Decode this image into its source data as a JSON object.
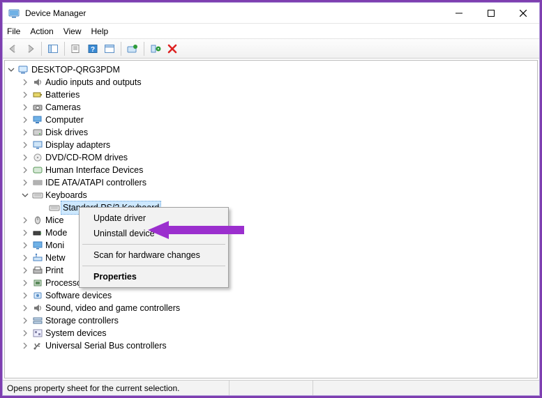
{
  "titlebar": {
    "title": "Device Manager"
  },
  "menu": {
    "file": "File",
    "action": "Action",
    "view": "View",
    "help": "Help"
  },
  "root": {
    "label": "DESKTOP-QRG3PDM"
  },
  "categories": [
    {
      "key": "audio",
      "label": "Audio inputs and outputs",
      "icon": "speaker"
    },
    {
      "key": "batteries",
      "label": "Batteries",
      "icon": "battery"
    },
    {
      "key": "cameras",
      "label": "Cameras",
      "icon": "camera"
    },
    {
      "key": "computer",
      "label": "Computer",
      "icon": "computer"
    },
    {
      "key": "disk",
      "label": "Disk drives",
      "icon": "disk"
    },
    {
      "key": "display",
      "label": "Display adapters",
      "icon": "display"
    },
    {
      "key": "dvd",
      "label": "DVD/CD-ROM drives",
      "icon": "dvd"
    },
    {
      "key": "hid",
      "label": "Human Interface Devices",
      "icon": "hid"
    },
    {
      "key": "ide",
      "label": "IDE ATA/ATAPI controllers",
      "icon": "ide"
    },
    {
      "key": "keyboards",
      "label": "Keyboards",
      "icon": "keyboard",
      "expanded": true,
      "children": [
        {
          "key": "ps2kb",
          "label": "Standard PS/2 Keyboard",
          "icon": "keyboard",
          "selected": true
        }
      ]
    },
    {
      "key": "mice",
      "label": "Mice",
      "icon": "mouse",
      "truncated": true
    },
    {
      "key": "modems",
      "label": "Mode",
      "icon": "modem",
      "truncated": true
    },
    {
      "key": "monitors",
      "label": "Moni",
      "icon": "monitor",
      "truncated": true
    },
    {
      "key": "network",
      "label": "Netw",
      "icon": "network",
      "truncated": true
    },
    {
      "key": "print",
      "label": "Print",
      "icon": "printer",
      "truncated": true
    },
    {
      "key": "processors",
      "label": "Processors",
      "icon": "cpu",
      "truncated": true
    },
    {
      "key": "software",
      "label": "Software devices",
      "icon": "software"
    },
    {
      "key": "sound",
      "label": "Sound, video and game controllers",
      "icon": "speaker"
    },
    {
      "key": "storage",
      "label": "Storage controllers",
      "icon": "storage"
    },
    {
      "key": "system",
      "label": "System devices",
      "icon": "system"
    },
    {
      "key": "usb",
      "label": "Universal Serial Bus controllers",
      "icon": "usb"
    }
  ],
  "context_menu": {
    "update": "Update driver",
    "uninstall": "Uninstall device",
    "scan": "Scan for hardware changes",
    "properties": "Properties"
  },
  "status": {
    "text": "Opens property sheet for the current selection."
  }
}
